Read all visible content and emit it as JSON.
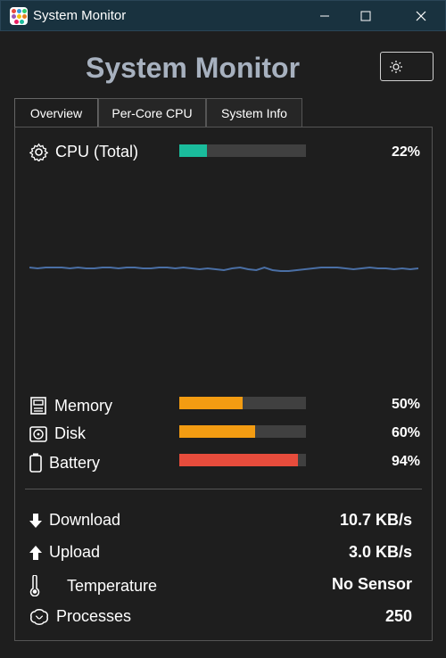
{
  "window": {
    "title": "System Monitor"
  },
  "header": {
    "title": "System Monitor",
    "theme_icon": "sun-icon"
  },
  "tabs": [
    {
      "label": "Overview",
      "active": true
    },
    {
      "label": "Per-Core CPU",
      "active": false
    },
    {
      "label": "System Info",
      "active": false
    }
  ],
  "cpu": {
    "label": "CPU (Total)",
    "value_text": "22%",
    "value": 0.22,
    "color": "#1abc9c"
  },
  "history": {
    "color": "#4a6fa5",
    "points": [
      50,
      49,
      50,
      50,
      50,
      49,
      50,
      49,
      49,
      50,
      50,
      49,
      50,
      50,
      49,
      49,
      50,
      50,
      49,
      50,
      49,
      48,
      49,
      48,
      47,
      49,
      50,
      48,
      47,
      50,
      47,
      46,
      46,
      47,
      48,
      49,
      50,
      50,
      50,
      49,
      48,
      49,
      50,
      49,
      49,
      48,
      49,
      48,
      49
    ]
  },
  "resources": [
    {
      "label": "Memory",
      "icon": "memory-icon",
      "value_text": "50%",
      "value": 0.5,
      "color": "#f39c12"
    },
    {
      "label": "Disk",
      "icon": "disk-icon",
      "value_text": "60%",
      "value": 0.6,
      "color": "#f39c12"
    },
    {
      "label": "Battery",
      "icon": "battery-icon",
      "value_text": "94%",
      "value": 0.94,
      "color": "#e74c3c"
    }
  ],
  "stats": [
    {
      "label": "Download",
      "icon": "download-arrow-icon",
      "value": "10.7 KB/s"
    },
    {
      "label": "Upload",
      "icon": "upload-arrow-icon",
      "value": "3.0 KB/s"
    },
    {
      "label": "Temperature",
      "icon": "thermometer-icon",
      "value": "No Sensor"
    },
    {
      "label": "Processes",
      "icon": "processes-icon",
      "value": "250"
    }
  ]
}
